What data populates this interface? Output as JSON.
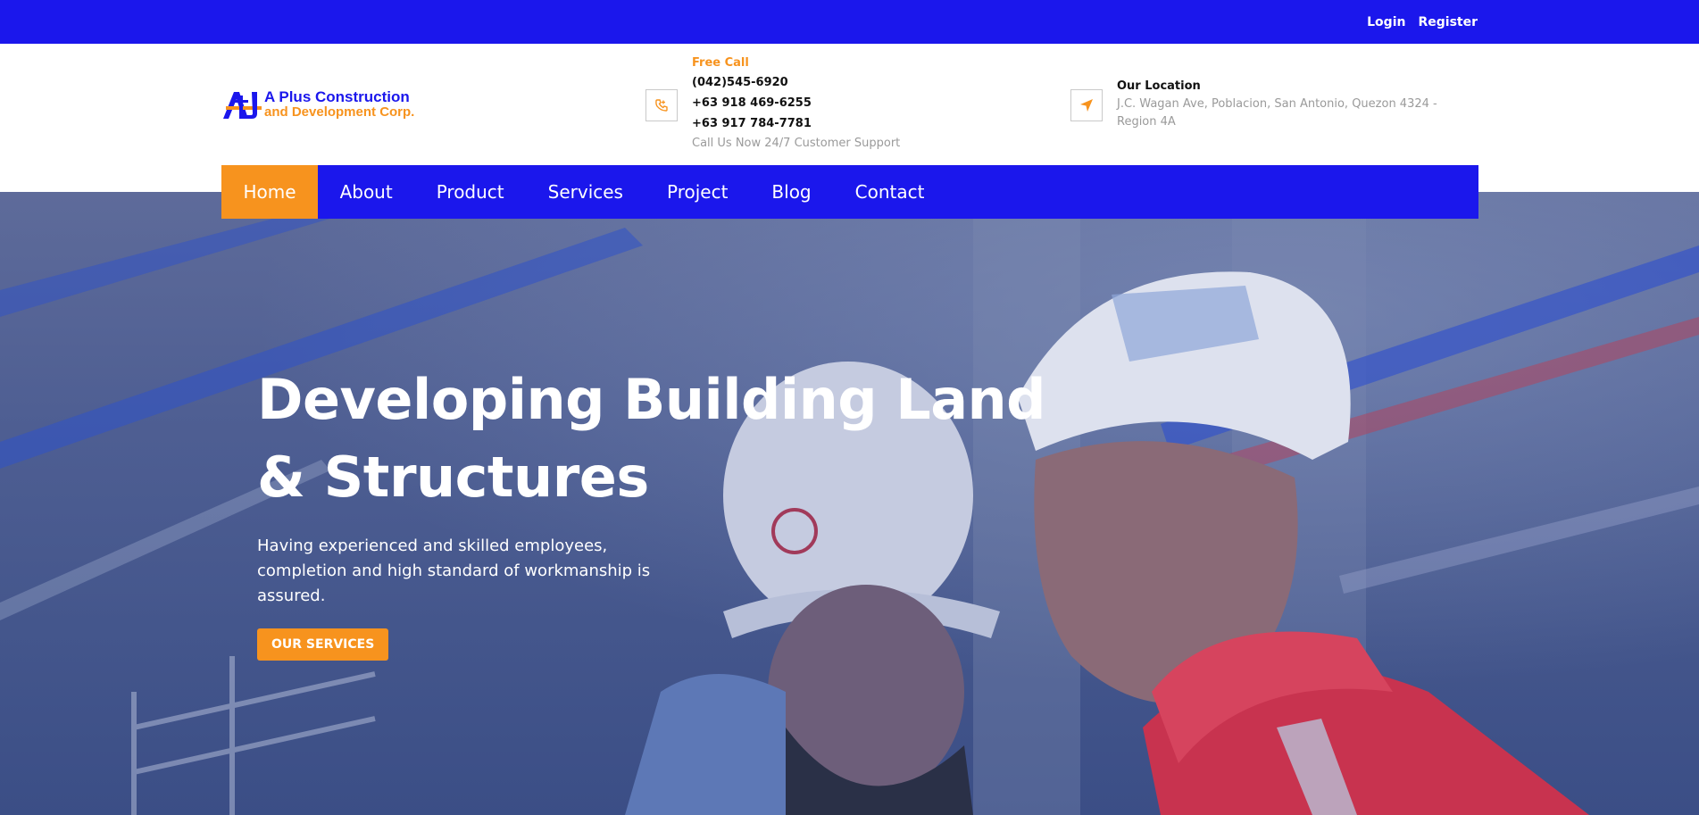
{
  "topbar": {
    "login": "Login",
    "register": "Register"
  },
  "logo": {
    "line1": "A Plus Construction",
    "line2": "and Development Corp."
  },
  "call": {
    "label": "Free Call",
    "numbers": [
      "(042)545-6920",
      "+63 918 469-6255",
      "+63 917 784-7781"
    ],
    "note": "Call Us Now 24/7 Customer Support"
  },
  "location": {
    "title": "Our Location",
    "address": "J.C. Wagan Ave, Poblacion, San Antonio, Quezon 4324 - Region 4A"
  },
  "nav": {
    "items": [
      "Home",
      "About",
      "Product",
      "Services",
      "Project",
      "Blog",
      "Contact"
    ],
    "active": "Home"
  },
  "hero": {
    "title": "Developing Building Land & Structures",
    "subtitle": "Having experienced and skilled employees, completion and high standard of workmanship is assured.",
    "cta": "OUR SERVICES"
  },
  "colors": {
    "primary": "#1b17ec",
    "accent": "#f7931e"
  }
}
